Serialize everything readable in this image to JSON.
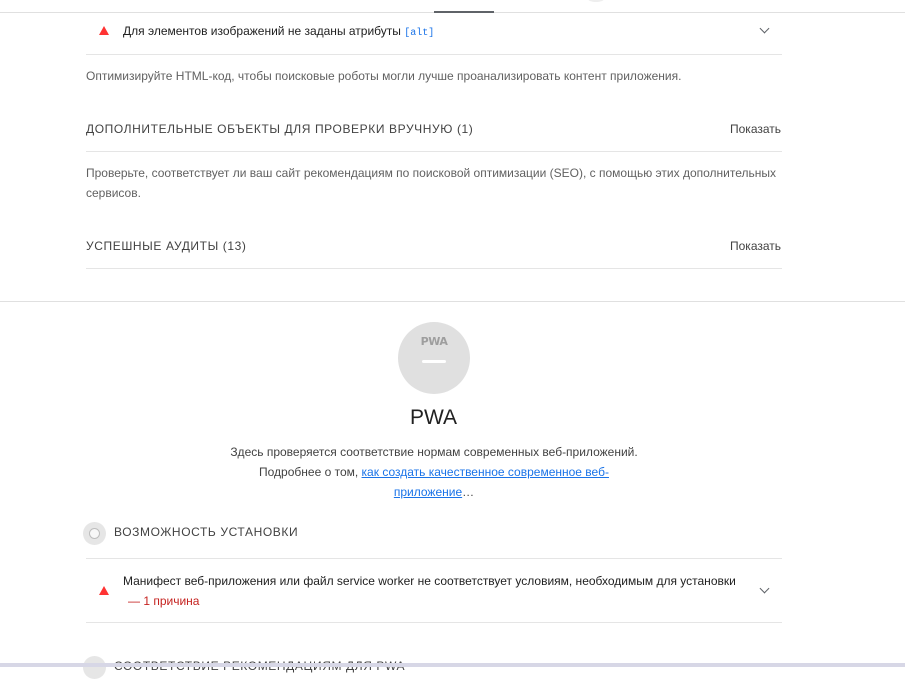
{
  "seo": {
    "alt_audit": {
      "title": "Для элементов изображений не заданы атрибуты",
      "code": "[alt]"
    },
    "html_hint": "Оптимизируйте HTML-код, чтобы поисковые роботы могли лучше проанализировать контент приложения.",
    "manual": {
      "title": "ДОПОЛНИТЕЛЬНЫЕ ОБЪЕКТЫ ДЛЯ ПРОВЕРКИ ВРУЧНУЮ",
      "count": "(1)",
      "show_label": "Показать",
      "description": "Проверьте, соответствует ли ваш сайт рекомендациям по поисковой оптимизации (SEO), с помощью этих дополнительных сервисов."
    },
    "passed": {
      "title": "УСПЕШНЫЕ АУДИТЫ",
      "count": "(13)",
      "show_label": "Показать"
    }
  },
  "pwa": {
    "gauge_label": "PWA",
    "title": "PWA",
    "description_before": "Здесь проверяется соответствие нормам современных веб-приложений. Подробнее о том, ",
    "link_text": "как создать качественное современное веб-приложение",
    "ellipsis": "…",
    "install_group": {
      "title": "ВОЗМОЖНОСТЬ УСТАНОВКИ",
      "audit_title": "Манифест веб-приложения или файл service worker не соответствует условиям, необходимым для установки",
      "reason": "— 1 причина"
    },
    "next_group_title": "СООТВЕТСТВИЕ РЕКОМЕНДАЦИЯМ ДЛЯ PWA"
  },
  "colors": {
    "fail": "#ff3333",
    "link": "#1a73e8",
    "reason": "#c5221f"
  }
}
